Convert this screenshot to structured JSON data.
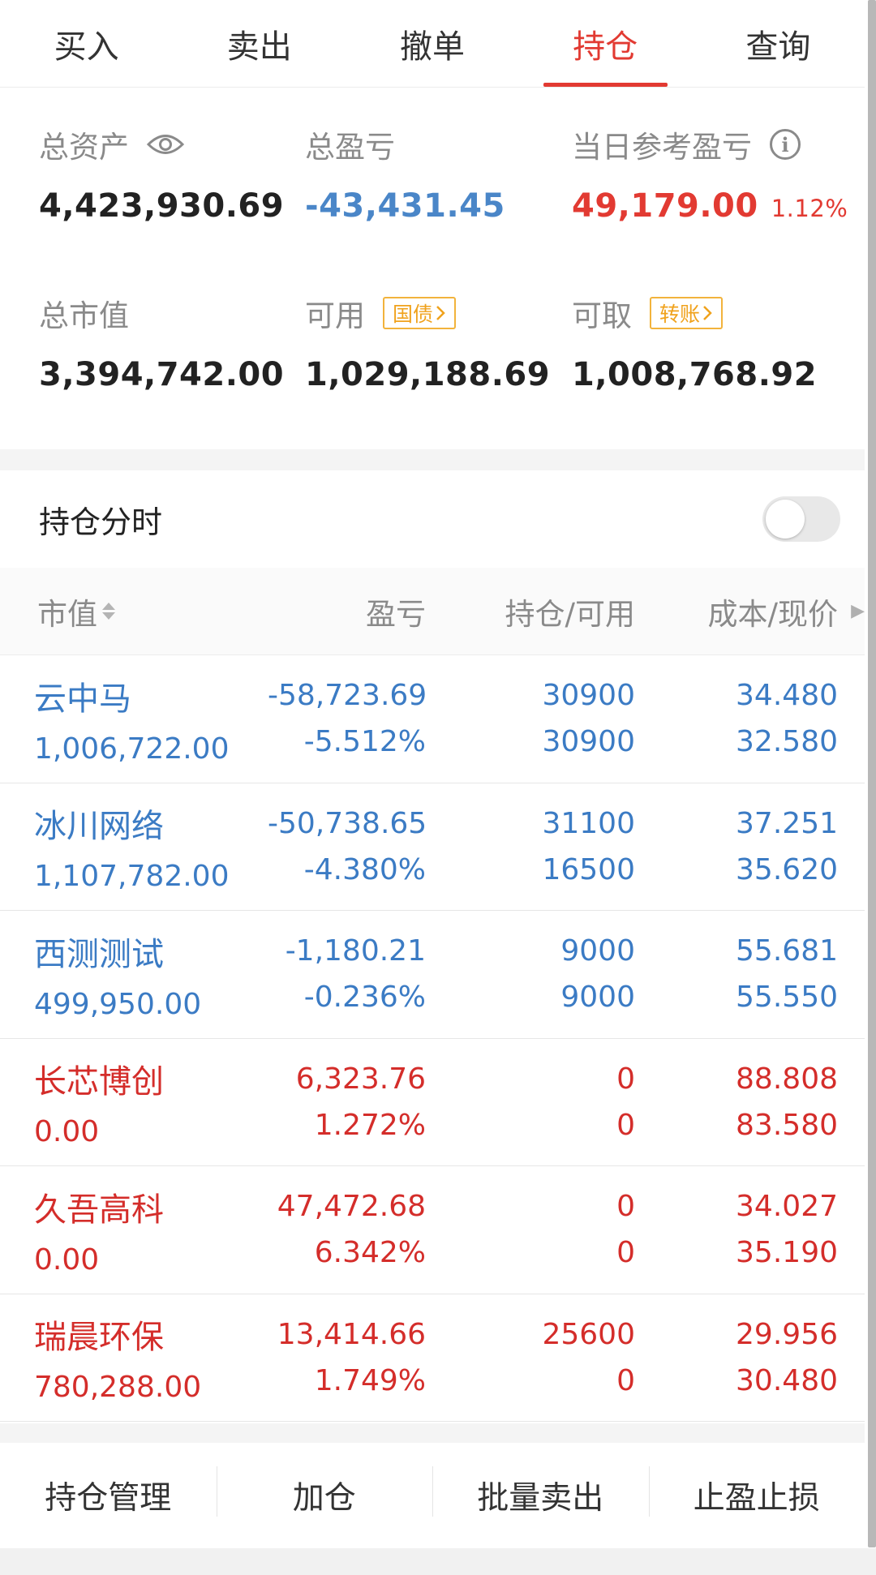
{
  "tabs": [
    "买入",
    "卖出",
    "撤单",
    "持仓",
    "查询"
  ],
  "active_tab": "持仓",
  "summary": {
    "total_assets_label": "总资产",
    "total_assets_value": "4,423,930.69",
    "total_pnl_label": "总盈亏",
    "total_pnl_value": "-43,431.45",
    "daily_pnl_label": "当日参考盈亏",
    "daily_pnl_value": "49,179.00",
    "daily_pnl_pct": "1.12%",
    "market_value_label": "总市值",
    "market_value_value": "3,394,742.00",
    "available_label": "可用",
    "available_tag": "国债",
    "available_value": "1,029,188.69",
    "withdrawable_label": "可取",
    "withdrawable_tag": "转账",
    "withdrawable_value": "1,008,768.92"
  },
  "toggle_row": {
    "title": "持仓分时",
    "enabled": false
  },
  "table_header": {
    "col1": "市值",
    "col2": "盈亏",
    "col3": "持仓/可用",
    "col4": "成本/现价"
  },
  "rows": [
    {
      "name": "云中马",
      "market_value": "1,006,722.00",
      "pnl": "-58,723.69",
      "pnl_pct": "-5.512%",
      "position": "30900",
      "available": "30900",
      "cost": "34.480",
      "price": "32.580",
      "color": "blue"
    },
    {
      "name": "冰川网络",
      "market_value": "1,107,782.00",
      "pnl": "-50,738.65",
      "pnl_pct": "-4.380%",
      "position": "31100",
      "available": "16500",
      "cost": "37.251",
      "price": "35.620",
      "color": "blue"
    },
    {
      "name": "西测测试",
      "market_value": "499,950.00",
      "pnl": "-1,180.21",
      "pnl_pct": "-0.236%",
      "position": "9000",
      "available": "9000",
      "cost": "55.681",
      "price": "55.550",
      "color": "blue"
    },
    {
      "name": "长芯博创",
      "market_value": "0.00",
      "pnl": "6,323.76",
      "pnl_pct": "1.272%",
      "position": "0",
      "available": "0",
      "cost": "88.808",
      "price": "83.580",
      "color": "red"
    },
    {
      "name": "久吾高科",
      "market_value": "0.00",
      "pnl": "47,472.68",
      "pnl_pct": "6.342%",
      "position": "0",
      "available": "0",
      "cost": "34.027",
      "price": "35.190",
      "color": "red"
    },
    {
      "name": "瑞晨环保",
      "market_value": "780,288.00",
      "pnl": "13,414.66",
      "pnl_pct": "1.749%",
      "position": "25600",
      "available": "0",
      "cost": "29.956",
      "price": "30.480",
      "color": "red"
    }
  ],
  "actions": [
    "持仓管理",
    "加仓",
    "批量卖出",
    "止盈止损"
  ],
  "colors": {
    "accent_red": "#e23a32",
    "loss_blue": "#3b7bc4",
    "tag_orange": "#f0a21c"
  }
}
